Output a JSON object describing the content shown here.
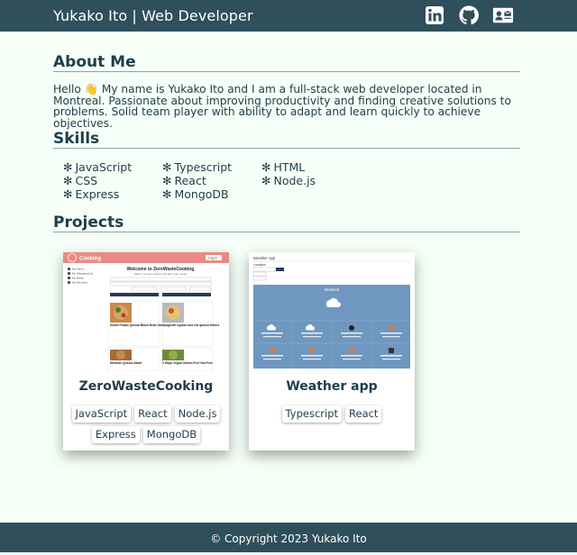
{
  "header": {
    "brand": "Yukako Ito | Web Developer",
    "icons": [
      "linkedin-icon",
      "github-icon",
      "contact-card-icon"
    ]
  },
  "about": {
    "title": "About Me",
    "text": "Hello 👋 My name is Yukako Ito and I am a full-stack web developer located in Montreal. Passionate about improving productivity and finding creative solutions to problems. Solid team player with ability to adapt and learn quickly to achieve objectives."
  },
  "skills": {
    "title": "Skills",
    "bullet": "✻",
    "items": [
      "JavaScript",
      "Typescript",
      "HTML",
      "CSS",
      "React",
      "Node.js",
      "Express",
      "MongoDB"
    ]
  },
  "projects": {
    "title": "Projects",
    "items": [
      {
        "title": "ZeroWasteCooking",
        "tags": [
          "JavaScript",
          "React",
          "Node.js",
          "Express",
          "MongoDB"
        ],
        "screenshot": {
          "app_name": "Cooking",
          "login": "Log in",
          "welcome": "Welcome to ZeroWasteCooking",
          "subtitle": "Sign in to save recipes and plan your meals",
          "sidebar": [
            "My Pantry",
            "My Shopping List",
            "My Meals",
            "My Favorites"
          ],
          "recipes": [
            "Sweet Potato Quinoa Black Bean Salad",
            "Spaghetti squash and red quinoa fritters",
            "Mexican Quinoa Salad",
            "3 Ways Vegan Gluten-Free Nut-Free"
          ]
        }
      },
      {
        "title": "Weather app",
        "tags": [
          "Typescript",
          "React"
        ],
        "screenshot": {
          "app_name": "Weather App",
          "locations": "Locations",
          "city": "Montreal"
        }
      }
    ]
  },
  "footer": {
    "text": "© Copyright 2023 Yukako Ito"
  },
  "colors": {
    "header_bg": "#2f4f5a",
    "page_bg": "#f5fff7",
    "text": "#1f3d4a",
    "accent_pink": "#e98a86",
    "weather_blue": "#6f97bf"
  }
}
